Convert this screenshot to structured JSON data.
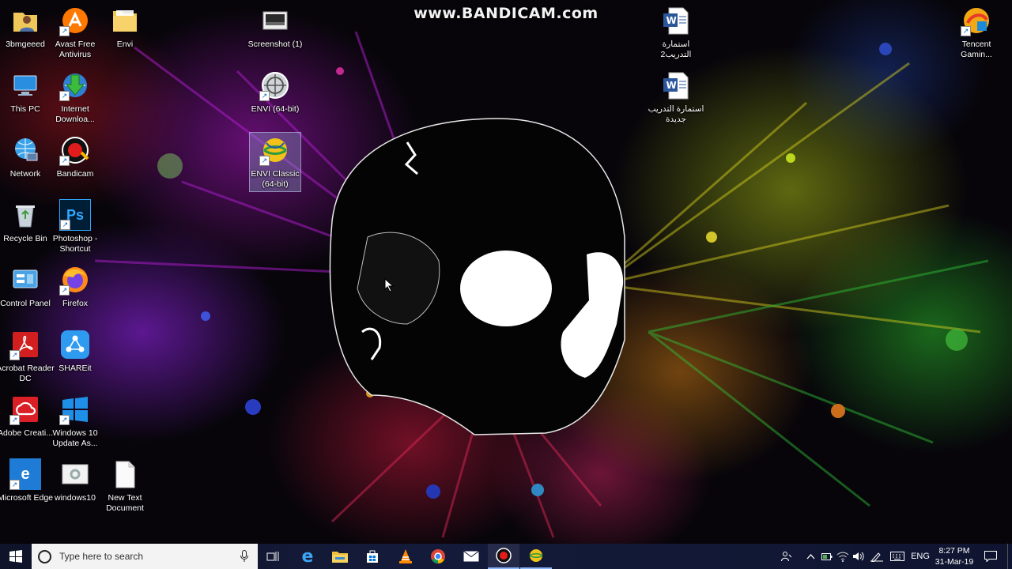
{
  "watermark": "www.BANDICAM.com",
  "desktop_icons": [
    {
      "label": "3bmgeeed",
      "icon": "user-folder-icon"
    },
    {
      "label": "Avast Free Antivirus",
      "icon": "avast-icon"
    },
    {
      "label": "Envi",
      "icon": "folder-icon"
    },
    {
      "label": "This PC",
      "icon": "this-pc-icon"
    },
    {
      "label": "Internet Downloa...",
      "icon": "idm-icon"
    },
    {
      "label": "Network",
      "icon": "network-icon"
    },
    {
      "label": "Bandicam",
      "icon": "bandicam-icon"
    },
    {
      "label": "Recycle Bin",
      "icon": "recycle-bin-icon"
    },
    {
      "label": "Photoshop - Shortcut",
      "icon": "photoshop-icon",
      "text": "Ps"
    },
    {
      "label": "Control Panel",
      "icon": "control-panel-icon"
    },
    {
      "label": "Firefox",
      "icon": "firefox-icon"
    },
    {
      "label": "Acrobat Reader DC",
      "icon": "acrobat-icon"
    },
    {
      "label": "SHAREit",
      "icon": "shareit-icon"
    },
    {
      "label": "Adobe Creati...",
      "icon": "creative-cloud-icon"
    },
    {
      "label": "Windows 10 Update As...",
      "icon": "windows-update-icon"
    },
    {
      "label": "Microsoft Edge",
      "icon": "edge-icon",
      "text": "e"
    },
    {
      "label": "windows10",
      "icon": "settings-file-icon"
    },
    {
      "label": "New Text Document",
      "icon": "text-document-icon"
    },
    {
      "label": "Screenshot (1)",
      "icon": "screenshot-icon"
    },
    {
      "label": "ENVI (64-bit)",
      "icon": "envi-icon"
    },
    {
      "label": "ENVI Classic (64-bit)",
      "icon": "envi-classic-icon"
    },
    {
      "label": "استمارة التدريب2",
      "icon": "word-doc-icon"
    },
    {
      "label": "استمارة التدريب جديدة",
      "icon": "word-doc-icon"
    },
    {
      "label": "Tencent Gamin...",
      "icon": "tencent-icon"
    }
  ],
  "taskbar": {
    "search_placeholder": "Type here to search",
    "pinned": [
      {
        "name": "task-view",
        "icon": "task-view-icon"
      },
      {
        "name": "edge",
        "icon": "edge-icon"
      },
      {
        "name": "file-explorer",
        "icon": "folder-icon"
      },
      {
        "name": "store",
        "icon": "store-icon"
      },
      {
        "name": "vlc",
        "icon": "vlc-icon"
      },
      {
        "name": "chrome",
        "icon": "chrome-icon"
      },
      {
        "name": "mail",
        "icon": "mail-icon"
      },
      {
        "name": "bandicam",
        "icon": "record-icon"
      },
      {
        "name": "envi-classic",
        "icon": "envi-classic-icon"
      }
    ],
    "tray": {
      "language": "ENG",
      "time": "8:27 PM",
      "date": "31-Mar-19"
    }
  },
  "colors": {
    "taskbar": "#141b3a",
    "search_bg": "#f3f3f3",
    "accent_blue": "#0078d7"
  }
}
